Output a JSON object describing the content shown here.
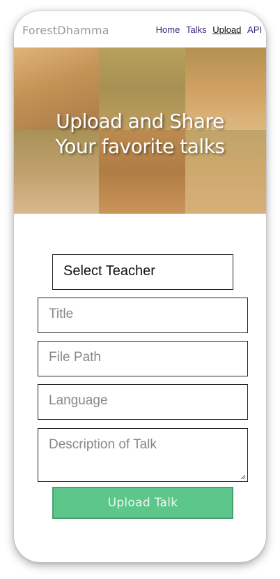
{
  "header": {
    "brand": "ForestDhamma",
    "nav": [
      {
        "label": "Home",
        "active": false
      },
      {
        "label": "Talks",
        "active": false
      },
      {
        "label": "Upload",
        "active": true
      },
      {
        "label": "API",
        "active": false
      }
    ]
  },
  "hero": {
    "title_line1": "Upload and Share",
    "title_line2": "Your favorite talks"
  },
  "form": {
    "teacher_select": "Select Teacher",
    "title_placeholder": "Title",
    "file_path_placeholder": "File Path",
    "language_placeholder": "Language",
    "description_placeholder": "Description of Talk",
    "submit_label": "Upload Talk"
  },
  "colors": {
    "brand_text": "#9a9a9a",
    "nav_link": "#3a1f7a",
    "hero_tint": "#d6a05c",
    "submit_bg": "#5cc68b"
  }
}
